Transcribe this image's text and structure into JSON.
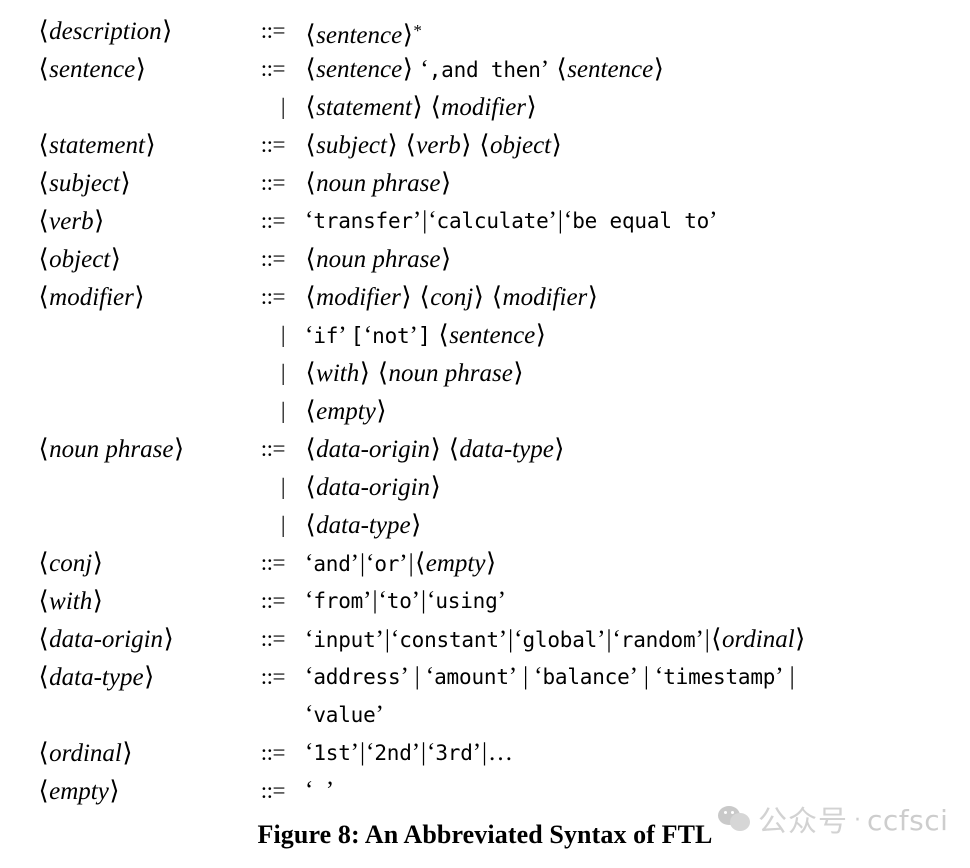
{
  "figure": {
    "caption": "Figure 8: An Abbreviated Syntax of FTL",
    "definition_operator": "::=",
    "alternative_operator": "|"
  },
  "grammar": {
    "title": "An Abbreviated Syntax of FTL",
    "rules": [
      {
        "lhs": "description",
        "op": "::=",
        "productions": [
          {
            "text": "⟨sentence⟩*",
            "tokens": [
              "sentence",
              "*"
            ]
          }
        ]
      },
      {
        "lhs": "sentence",
        "op": "::=",
        "productions": [
          {
            "text": "⟨sentence⟩ ‘,and then’ ⟨sentence⟩",
            "terminals": [
              ",and then"
            ],
            "nonterminals": [
              "sentence",
              "sentence"
            ]
          },
          {
            "text": "⟨statement⟩ ⟨modifier⟩",
            "nonterminals": [
              "statement",
              "modifier"
            ]
          }
        ]
      },
      {
        "lhs": "statement",
        "op": "::=",
        "productions": [
          {
            "text": "⟨subject⟩ ⟨verb⟩ ⟨object⟩",
            "nonterminals": [
              "subject",
              "verb",
              "object"
            ]
          }
        ]
      },
      {
        "lhs": "subject",
        "op": "::=",
        "productions": [
          {
            "text": "⟨noun phrase⟩",
            "nonterminals": [
              "noun phrase"
            ]
          }
        ]
      },
      {
        "lhs": "verb",
        "op": "::=",
        "productions": [
          {
            "text": "‘transfer’|‘calculate’|‘be equal to’",
            "terminals": [
              "transfer",
              "calculate",
              "be equal to"
            ]
          }
        ]
      },
      {
        "lhs": "object",
        "op": "::=",
        "productions": [
          {
            "text": "⟨noun phrase⟩",
            "nonterminals": [
              "noun phrase"
            ]
          }
        ]
      },
      {
        "lhs": "modifier",
        "op": "::=",
        "productions": [
          {
            "text": "⟨modifier⟩ ⟨conj⟩ ⟨modifier⟩",
            "nonterminals": [
              "modifier",
              "conj",
              "modifier"
            ]
          },
          {
            "text": "‘if’ [‘not’] ⟨sentence⟩",
            "terminals": [
              "if",
              "not"
            ],
            "nonterminals": [
              "sentence"
            ]
          },
          {
            "text": "⟨with⟩ ⟨noun phrase⟩",
            "nonterminals": [
              "with",
              "noun phrase"
            ]
          },
          {
            "text": "⟨empty⟩",
            "nonterminals": [
              "empty"
            ]
          }
        ]
      },
      {
        "lhs": "noun phrase",
        "op": "::=",
        "productions": [
          {
            "text": "⟨data-origin⟩ ⟨data-type⟩",
            "nonterminals": [
              "data-origin",
              "data-type"
            ]
          },
          {
            "text": "⟨data-origin⟩",
            "nonterminals": [
              "data-origin"
            ]
          },
          {
            "text": "⟨data-type⟩",
            "nonterminals": [
              "data-type"
            ]
          }
        ]
      },
      {
        "lhs": "conj",
        "op": "::=",
        "productions": [
          {
            "text": "‘and’|‘or’|⟨empty⟩",
            "terminals": [
              "and",
              "or"
            ],
            "nonterminals": [
              "empty"
            ]
          }
        ]
      },
      {
        "lhs": "with",
        "op": "::=",
        "productions": [
          {
            "text": "‘from’|‘to’|‘using’",
            "terminals": [
              "from",
              "to",
              "using"
            ]
          }
        ]
      },
      {
        "lhs": "data-origin",
        "op": "::=",
        "productions": [
          {
            "text": "‘input’|‘constant’|‘global’|‘random’|⟨ordinal⟩",
            "terminals": [
              "input",
              "constant",
              "global",
              "random"
            ],
            "nonterminals": [
              "ordinal"
            ]
          }
        ]
      },
      {
        "lhs": "data-type",
        "op": "::=",
        "productions": [
          {
            "text": "‘address’ | ‘amount’ | ‘balance’ | ‘timestamp’ |",
            "terminals": [
              "address",
              "amount",
              "balance",
              "timestamp"
            ]
          },
          {
            "text": "‘value’",
            "terminals": [
              "value"
            ],
            "continuation": true
          }
        ]
      },
      {
        "lhs": "ordinal",
        "op": "::=",
        "productions": [
          {
            "text": "‘1st’|‘2nd’|‘3rd’|…",
            "terminals": [
              "1st",
              "2nd",
              "3rd"
            ],
            "ellipsis": "…"
          }
        ]
      },
      {
        "lhs": "empty",
        "op": "::=",
        "productions": [
          {
            "text": "‘ ’",
            "terminals": [
              " "
            ]
          }
        ]
      }
    ],
    "labels": {
      "description": "description",
      "sentence": "sentence",
      "statement": "statement",
      "subject": "subject",
      "verb": "verb",
      "object": "object",
      "modifier": "modifier",
      "noun_phrase": "noun phrase",
      "conj": "conj",
      "with": "with",
      "data_origin": "data-origin",
      "data_type": "data-type",
      "ordinal": "ordinal",
      "empty": "empty"
    },
    "terminals": {
      "and_then": ",and then",
      "transfer": "transfer",
      "calculate": "calculate",
      "be_equal_to": "be equal to",
      "if": "if",
      "not": "not",
      "and": "and",
      "or": "or",
      "from": "from",
      "to": "to",
      "using": "using",
      "input": "input",
      "constant": "constant",
      "global": "global",
      "random": "random",
      "address": "address",
      "amount": "amount",
      "balance": "balance",
      "timestamp": "timestamp",
      "value": "value",
      "first": "1st",
      "second": "2nd",
      "third": "3rd",
      "ellipsis": "…",
      "blank": " "
    },
    "symbols": {
      "open_angle": "⟨",
      "close_angle": "⟩",
      "open_quote": "‘",
      "close_quote": "’",
      "open_bracket": "[",
      "close_bracket": "]",
      "star": "*",
      "bar": "|",
      "defines": "::="
    }
  },
  "watermark": {
    "chinese": "公众号",
    "separator": "·",
    "handle": "ccfsci",
    "color": "#d0d0d0",
    "icon": "wechat-logo-icon"
  },
  "colors": {
    "background": "#ffffff",
    "text": "#000000",
    "watermark": "#d0d0d0"
  }
}
